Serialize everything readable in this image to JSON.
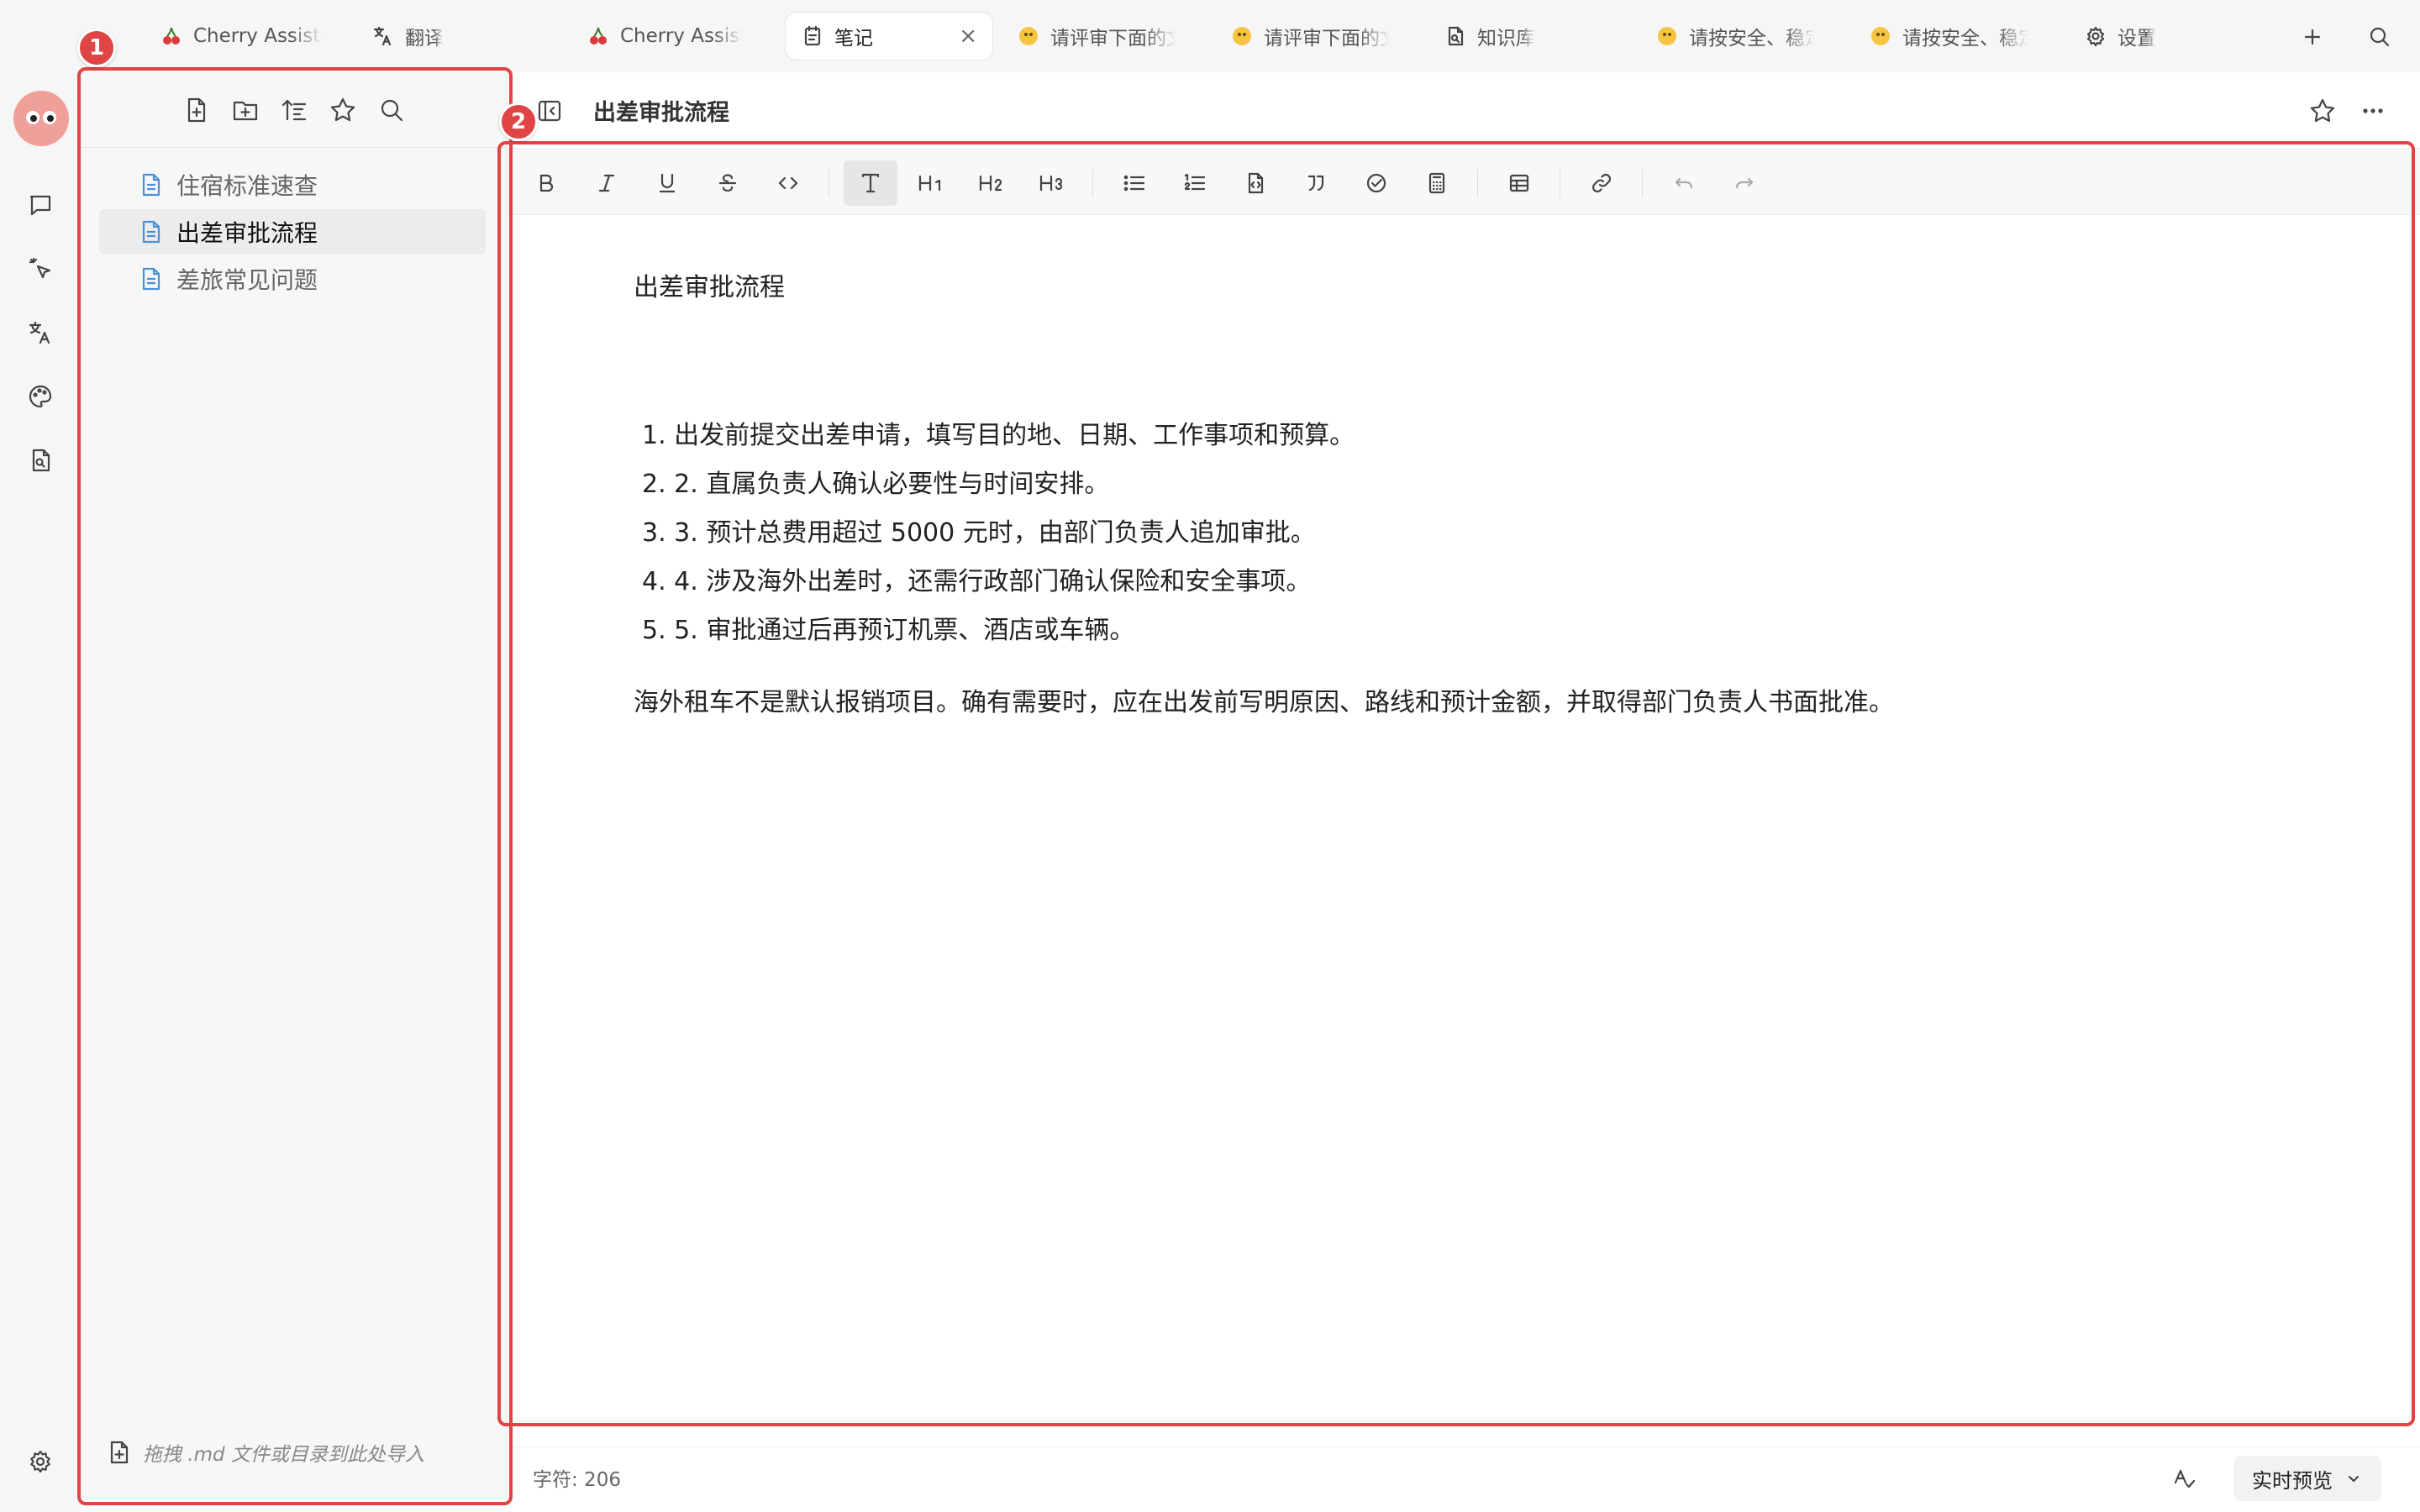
{
  "tabs": [
    {
      "label": "Cherry Assistant",
      "icon": "cherry-icon",
      "active": false
    },
    {
      "label": "翻译",
      "icon": "translate-icon",
      "active": false
    },
    {
      "label": "Cherry Assistant",
      "icon": "cherry-icon",
      "active": false
    },
    {
      "label": "笔记",
      "icon": "notes-icon",
      "active": true
    },
    {
      "label": "请评审下面的文档",
      "icon": "emoji-icon",
      "active": false
    },
    {
      "label": "请评审下面的文档",
      "icon": "emoji-icon",
      "active": false
    },
    {
      "label": "知识库",
      "icon": "knowledge-icon",
      "active": false
    },
    {
      "label": "请按安全、稳定",
      "icon": "emoji-icon",
      "active": false
    },
    {
      "label": "请按安全、稳定",
      "icon": "emoji-icon",
      "active": false
    },
    {
      "label": "设置",
      "icon": "gear-icon",
      "active": false
    }
  ],
  "tab_close": "×",
  "sidebar": {
    "files": [
      {
        "label": "住宿标准速查",
        "active": false
      },
      {
        "label": "出差审批流程",
        "active": true
      },
      {
        "label": "差旅常见问题",
        "active": false
      }
    ],
    "footer": "拖拽 .md 文件或目录到此处导入"
  },
  "note": {
    "title": "出差审批流程",
    "heading": "出差审批流程",
    "list": [
      "2. 直属负责人确认必要性与时间安排。",
      "3. 预计总费用超过 5000 元时，由部门负责人追加审批。",
      "4. 涉及海外出差时，还需行政部门确认保险和安全事项。",
      "5. 审批通过后再预订机票、酒店或车辆。"
    ],
    "list_first": "出发前提交出差申请，填写目的地、日期、工作事项和预算。",
    "list_prefixes": [
      "1.",
      "2.",
      "3.",
      "4.",
      "5."
    ],
    "paragraph": "海外租车不是默认报销项目。确有需要时，应在出发前写明原因、路线和预计金额，并取得部门负责人书面批准。"
  },
  "status": {
    "char_count": "字符: 206",
    "preview_mode": "实时预览"
  },
  "annotations": [
    "1",
    "2"
  ],
  "colors": {
    "annotation": "#e04444",
    "file_icon": "#4a90d9"
  }
}
